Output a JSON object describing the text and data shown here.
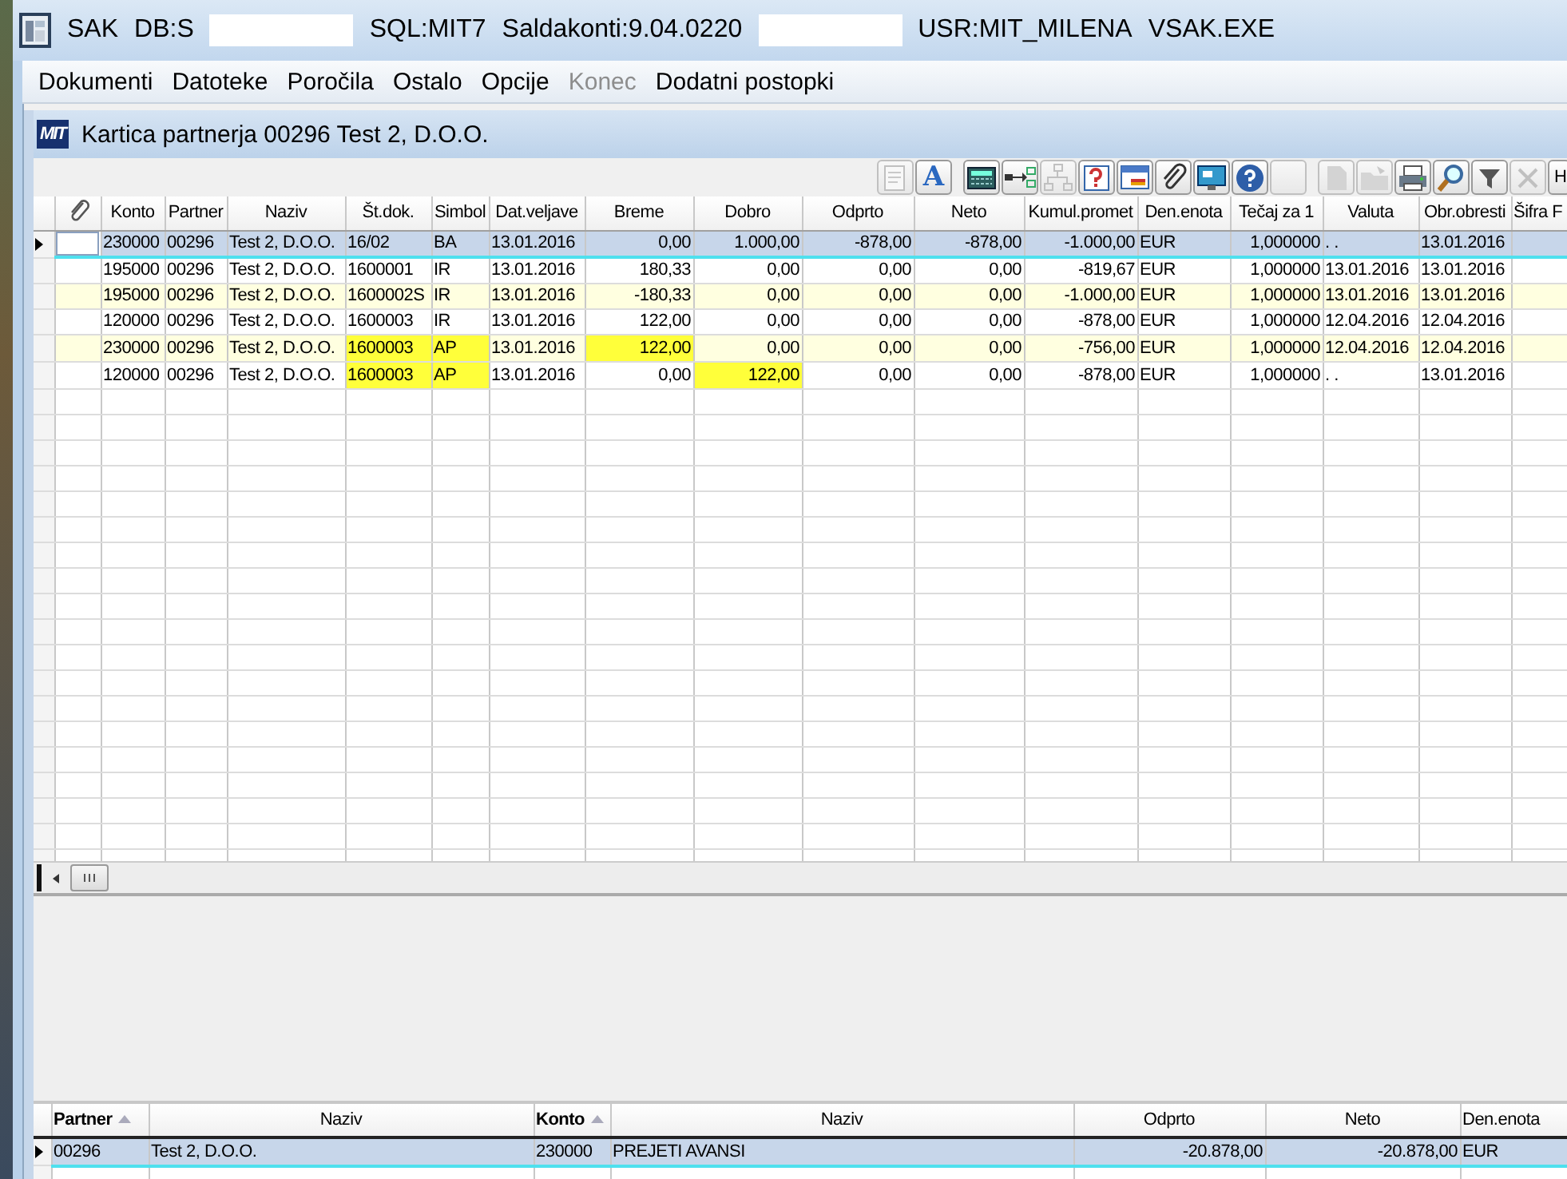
{
  "window": {
    "title_parts": [
      {
        "kind": "text",
        "text": "SAK"
      },
      {
        "kind": "text",
        "text": "DB:S"
      },
      {
        "kind": "redaction"
      },
      {
        "kind": "text",
        "text": "SQL:MIT7"
      },
      {
        "kind": "text",
        "text": "Saldakonti:9.04.0220"
      },
      {
        "kind": "redaction"
      },
      {
        "kind": "text",
        "text": "USR:MIT_MILENA"
      },
      {
        "kind": "text",
        "text": "VSAK.EXE"
      }
    ]
  },
  "menu": [
    {
      "label": "Dokumenti",
      "disabled": false
    },
    {
      "label": "Datoteke",
      "disabled": false
    },
    {
      "label": "Poročila",
      "disabled": false
    },
    {
      "label": "Ostalo",
      "disabled": false
    },
    {
      "label": "Opcije",
      "disabled": false
    },
    {
      "label": "Konec",
      "disabled": true
    },
    {
      "label": "Dodatni postopki",
      "disabled": false
    }
  ],
  "child_window": {
    "logo": "MIT",
    "title": "Kartica partnerja 00296 Test 2, D.O.O."
  },
  "toolbar": [
    {
      "kind": "document",
      "disabled": true
    },
    {
      "kind": "letter",
      "disabled": false,
      "label": "A"
    },
    {
      "kind": "calculator",
      "disabled": false
    },
    {
      "kind": "flow",
      "disabled": false
    },
    {
      "kind": "tree",
      "disabled": true
    },
    {
      "kind": "help-doc",
      "disabled": false
    },
    {
      "kind": "window",
      "disabled": false
    },
    {
      "kind": "paperclip",
      "disabled": false
    },
    {
      "kind": "monitor",
      "disabled": false
    },
    {
      "kind": "help",
      "disabled": false
    },
    {
      "kind": "blank",
      "disabled": true
    },
    {
      "kind": "page",
      "disabled": true
    },
    {
      "kind": "folder",
      "disabled": true
    },
    {
      "kind": "printer",
      "disabled": false
    },
    {
      "kind": "search",
      "disabled": false
    },
    {
      "kind": "filter",
      "disabled": false
    },
    {
      "kind": "close",
      "disabled": true
    },
    {
      "kind": "text",
      "disabled": false,
      "label": "H"
    }
  ],
  "table": {
    "columns": [
      {
        "label": "Konto",
        "kind": "text"
      },
      {
        "label": "Partner",
        "kind": "text"
      },
      {
        "label": "Naziv",
        "kind": "text"
      },
      {
        "label": "Št.dok.",
        "kind": "text"
      },
      {
        "label": "Simbol",
        "kind": "text"
      },
      {
        "label": "Dat.veljave",
        "kind": "text"
      },
      {
        "label": "Breme",
        "kind": "amount"
      },
      {
        "label": "Dobro",
        "kind": "amount"
      },
      {
        "label": "Odprto",
        "kind": "amount"
      },
      {
        "label": "Neto",
        "kind": "amount"
      },
      {
        "label": "Kumul.promet",
        "kind": "amount"
      },
      {
        "label": "Den.enota",
        "kind": "text"
      },
      {
        "label": "Tečaj za 1",
        "kind": "amount"
      },
      {
        "label": "Valuta",
        "kind": "text"
      },
      {
        "label": "Obr.obresti",
        "kind": "text"
      },
      {
        "label": "Šifra F",
        "kind": "text"
      }
    ],
    "rows": [
      {
        "selected": true,
        "highlighted": [],
        "cells": [
          "230000",
          "00296",
          "Test 2, D.O.O.",
          "16/02",
          "BA",
          "13.01.2016",
          "0,00",
          "1.000,00",
          "-878,00",
          "-878,00",
          "-1.000,00",
          "EUR",
          "1,000000",
          ". .",
          "13.01.2016"
        ]
      },
      {
        "selected": false,
        "highlighted": [],
        "cells": [
          "195000",
          "00296",
          "Test 2, D.O.O.",
          "1600001",
          "IR",
          "13.01.2016",
          "180,33",
          "0,00",
          "0,00",
          "0,00",
          "-819,67",
          "EUR",
          "1,000000",
          "13.01.2016",
          "13.01.2016"
        ]
      },
      {
        "selected": false,
        "highlighted": [],
        "cells": [
          "195000",
          "00296",
          "Test 2, D.O.O.",
          "1600002S",
          "IR",
          "13.01.2016",
          "-180,33",
          "0,00",
          "0,00",
          "0,00",
          "-1.000,00",
          "EUR",
          "1,000000",
          "13.01.2016",
          "13.01.2016"
        ]
      },
      {
        "selected": false,
        "highlighted": [],
        "cells": [
          "120000",
          "00296",
          "Test 2, D.O.O.",
          "1600003",
          "IR",
          "13.01.2016",
          "122,00",
          "0,00",
          "0,00",
          "0,00",
          "-878,00",
          "EUR",
          "1,000000",
          "12.04.2016",
          "12.04.2016"
        ]
      },
      {
        "selected": false,
        "highlighted": [
          false,
          false,
          false,
          true,
          true,
          false,
          true,
          false,
          false,
          false,
          false,
          false,
          false,
          false,
          false
        ],
        "cells": [
          "230000",
          "00296",
          "Test 2, D.O.O.",
          "1600003",
          "AP",
          "13.01.2016",
          "122,00",
          "0,00",
          "0,00",
          "0,00",
          "-756,00",
          "EUR",
          "1,000000",
          "12.04.2016",
          "12.04.2016"
        ]
      },
      {
        "selected": false,
        "highlighted": [
          false,
          false,
          false,
          true,
          true,
          false,
          false,
          true,
          false,
          false,
          false,
          false,
          false,
          false,
          false
        ],
        "cells": [
          "120000",
          "00296",
          "Test 2, D.O.O.",
          "1600003",
          "AP",
          "13.01.2016",
          "0,00",
          "122,00",
          "0,00",
          "0,00",
          "-878,00",
          "EUR",
          "1,000000",
          ". .",
          "13.01.2016"
        ]
      }
    ]
  },
  "summary_table": {
    "columns": [
      {
        "label": "Partner",
        "kind": "text",
        "sorted": true
      },
      {
        "label": "Naziv",
        "kind": "text",
        "sorted": false
      },
      {
        "label": "Konto",
        "kind": "text",
        "sorted": true
      },
      {
        "label": "Naziv",
        "kind": "text",
        "sorted": false
      },
      {
        "label": "Odprto",
        "kind": "amount",
        "sorted": false
      },
      {
        "label": "Neto",
        "kind": "amount",
        "sorted": false
      },
      {
        "label": "Den.enota",
        "kind": "text",
        "sorted": false
      }
    ],
    "rows": [
      {
        "selected": true,
        "highlighted": [],
        "cells": [
          "00296",
          "Test 2, D.O.O.",
          "230000",
          "PREJETI AVANSI",
          "-20.878,00",
          "-20.878,00",
          "EUR"
        ]
      }
    ]
  }
}
